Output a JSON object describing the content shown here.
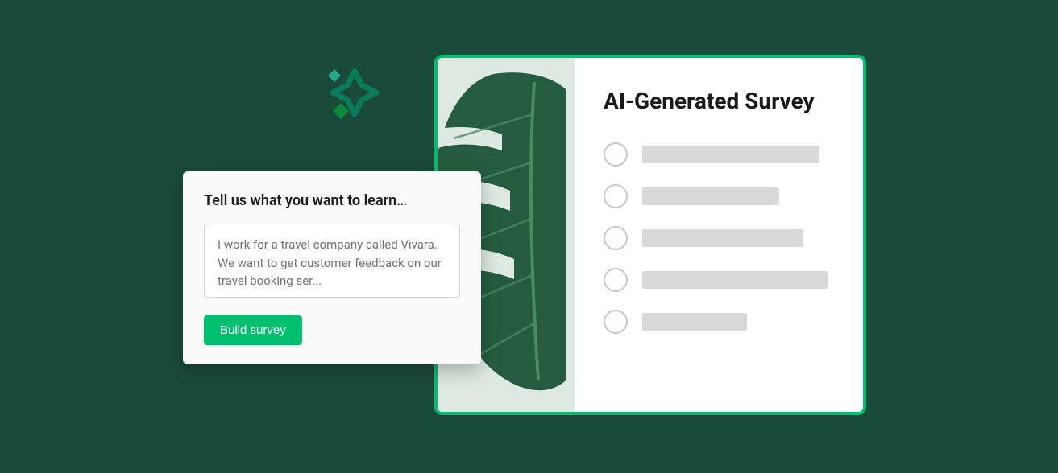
{
  "prompt": {
    "title": "Tell us what you want to learn…",
    "textarea_value": "I work for a travel company called Vivara. We want to get customer feedback on our travel booking ser...",
    "button_label": "Build survey"
  },
  "survey": {
    "title": "AI-Generated Survey"
  }
}
